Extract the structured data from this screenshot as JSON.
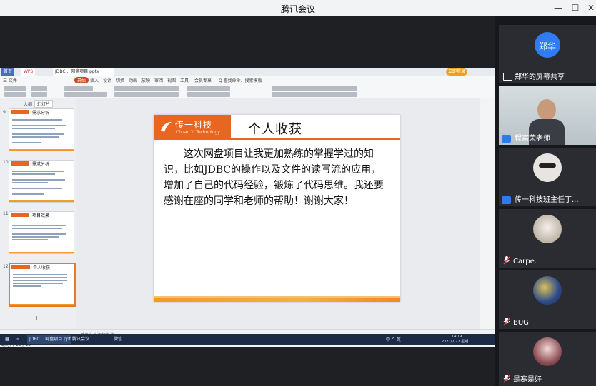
{
  "window": {
    "title": "腾讯会议",
    "minimize": "—",
    "maximize": "☐",
    "close": "✕"
  },
  "wps": {
    "tab_home": "首页",
    "tab_wps": "WPS",
    "tab_doc": "JDBC... 网盘项目.pptx",
    "tab_plus": "+",
    "login": "立即登录",
    "menu": [
      "三 文件",
      "开始",
      "插入",
      "设计",
      "切换",
      "动画",
      "放映",
      "审阅",
      "视图",
      "工具",
      "会员专享",
      "Q 查找命令、搜索模板"
    ],
    "menu_active": "开始",
    "sidebar_tabs": [
      "大纲",
      "幻灯片"
    ],
    "slides": [
      {
        "num": "9",
        "title": "需求分析"
      },
      {
        "num": "10",
        "title": "需求分析"
      },
      {
        "num": "11",
        "title": "项目效果"
      },
      {
        "num": "12",
        "title": "个人收获"
      }
    ],
    "notes_placeholder": "单击此处添加备注",
    "slide_count": "幻灯片 12 / 12",
    "zoom": "—  +",
    "add_slide": "+"
  },
  "slide": {
    "logo_name": "传一科技",
    "logo_sub": "Chuan Yi Technology",
    "title": "个人收获",
    "body": "这次网盘项目让我更加熟练的掌握学过的知识，比如JDBC的操作以及文件的读写流的应用，增加了自己的代码经验，锻炼了代码思维。我还要感谢在座的同学和老师的帮助！谢谢大家！"
  },
  "taskbar": {
    "items": [
      "JDBC... 网盘项目.pptx",
      "腾讯会议",
      "微信"
    ],
    "tray": "中 ^ 英",
    "time": "14:19",
    "date": "2021/7/27 星期二"
  },
  "participants": [
    {
      "name": "郑华的屏幕共享",
      "avatar_text": "郑华",
      "avatar_color": "#2f7cf6"
    },
    {
      "name": "程富荣老师"
    },
    {
      "name": "传一科技班主任丁..."
    },
    {
      "name": "Carpe."
    },
    {
      "name": "BUG"
    },
    {
      "name": "是寒是好"
    }
  ],
  "colors": {
    "accent": "#e8661f",
    "wps_active": "#c64a1c",
    "meeting_bg": "#1f2023"
  }
}
